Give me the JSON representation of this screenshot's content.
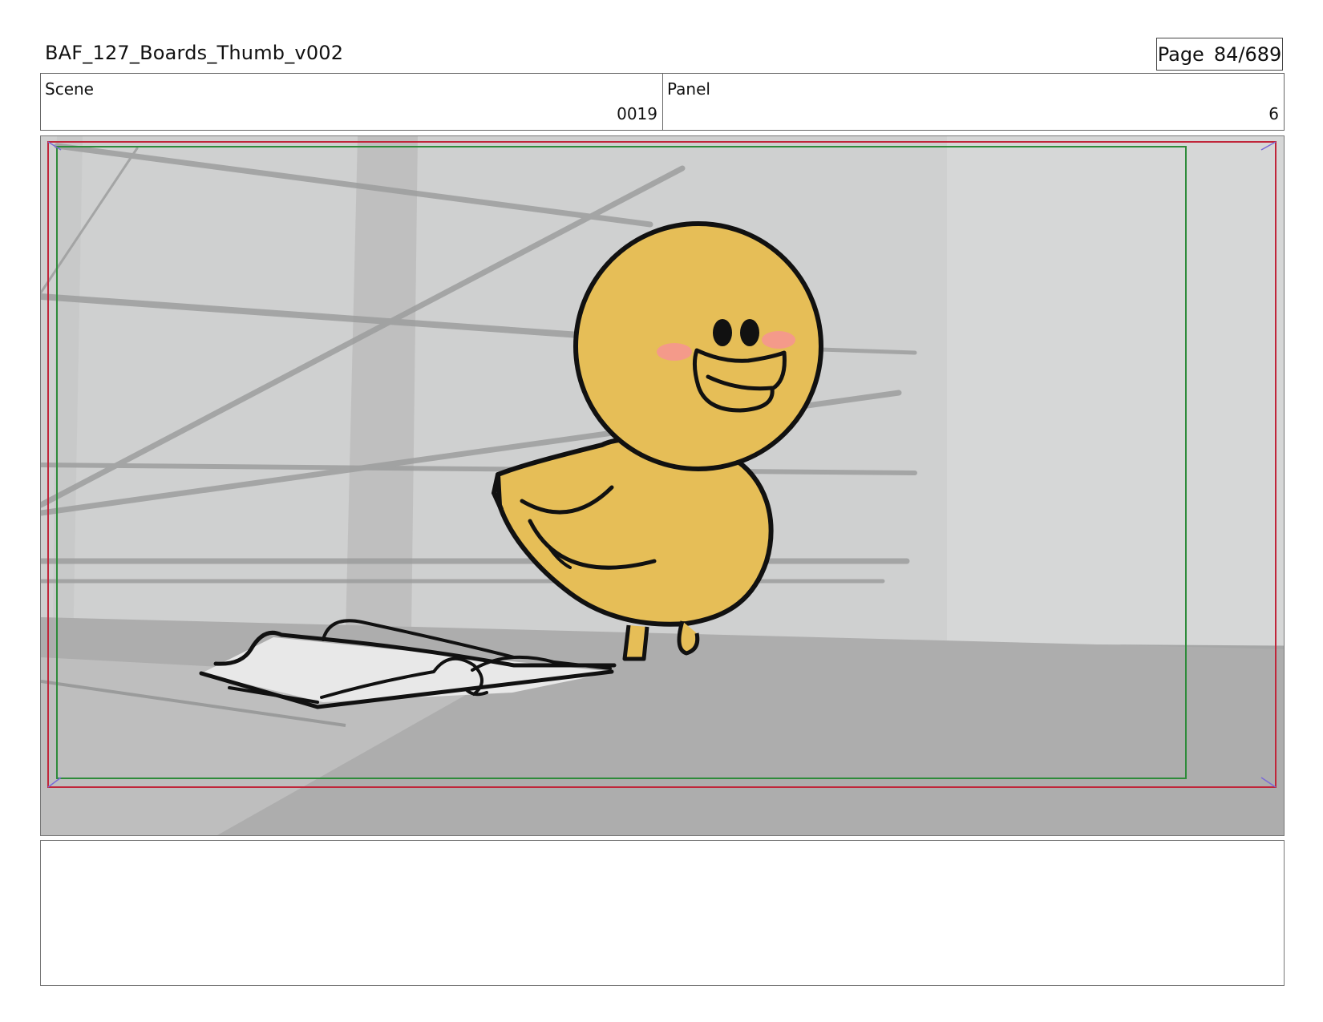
{
  "header": {
    "title": "BAF_127_Boards_Thumb_v002",
    "page_label": "Page",
    "page_number": "84/689"
  },
  "info": {
    "scene_label": "Scene",
    "scene_value": "0019",
    "panel_label": "Panel",
    "panel_value": "6"
  },
  "colors": {
    "safe_frame": "#2e8b3a",
    "action_frame": "#c0263a",
    "character_fill": "#e6be57",
    "blush": "#f49a8a",
    "background": "#cfd0d0",
    "floor": "#adadad"
  },
  "illustration": {
    "subject_icon": "yellow-chick-icon",
    "prop_icon": "open-book-icon"
  },
  "notes": {
    "text": ""
  }
}
